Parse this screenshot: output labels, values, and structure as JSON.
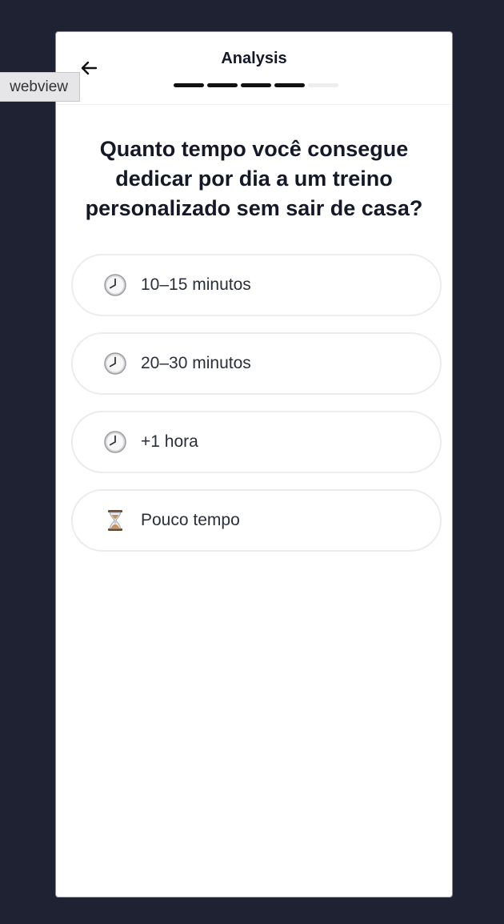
{
  "webview_tag": "webview",
  "header": {
    "title": "Analysis",
    "progress": {
      "completed_steps": 4,
      "total_steps": 5
    }
  },
  "question": "Quanto tempo você consegue dedicar por dia a um treino personalizado sem sair de casa?",
  "options": [
    {
      "icon": "clock-icon",
      "label": "10–15 minutos"
    },
    {
      "icon": "clock-icon",
      "label": "20–30 minutos"
    },
    {
      "icon": "clock-icon",
      "label": "+1 hora"
    },
    {
      "icon": "hourglass-icon",
      "label": "Pouco tempo"
    }
  ],
  "colors": {
    "background": "#1e2232",
    "text": "#151827",
    "progress_active": "#111111",
    "progress_inactive": "#eeeeef",
    "option_border": "#ececef"
  }
}
